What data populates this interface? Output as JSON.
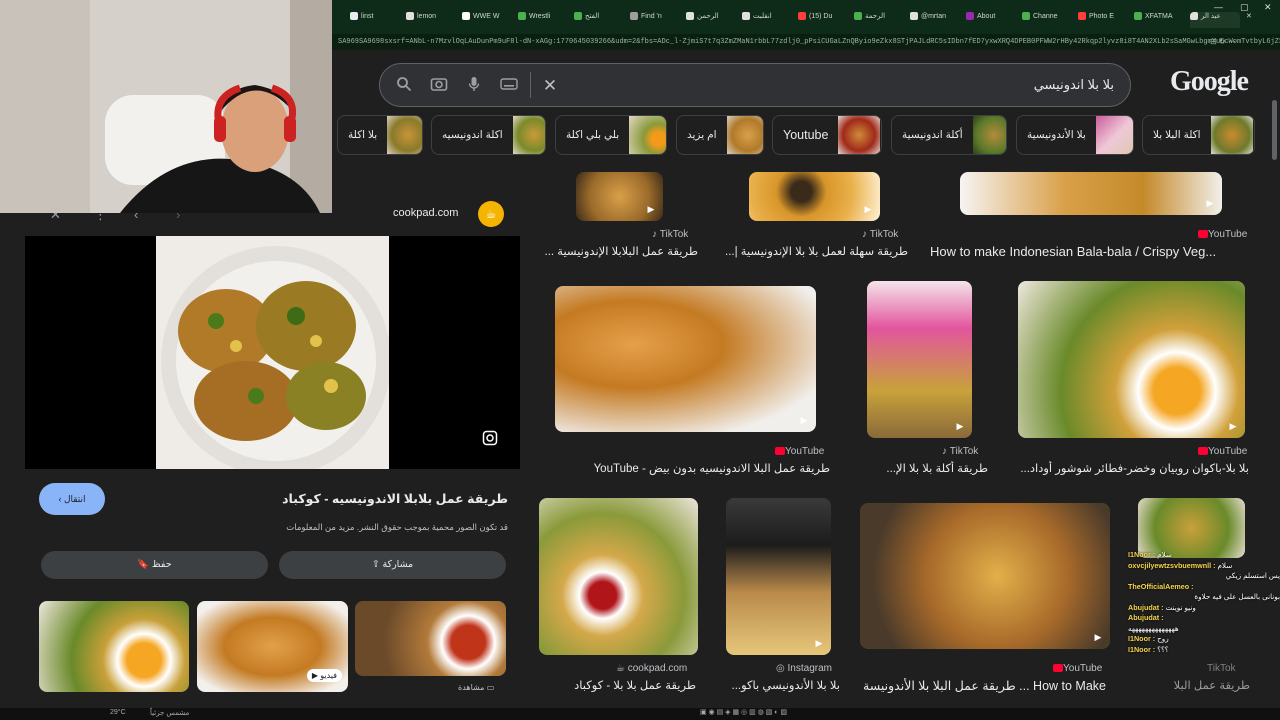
{
  "browser": {
    "tabs": [
      "linst",
      "lemon",
      "WWE W",
      "Wrestli",
      "الفتح",
      "Find 'n",
      "الرحمن",
      "انقلبت",
      "(15) Du",
      "الرحمة",
      "@mrtan",
      "About",
      "Channe",
      "Photo E",
      "XFATMA",
      "عبد الر"
    ],
    "url": "SA969SA9698sxsrf=ANbL-n7MzvlOqLAuDunPm9uF8l-dN-xAGg:1770645039266&udm=2&fbs=ADc_l-ZjmiS7t7q3ZmZMaN1rbbL77zdlj0_pPsiCUGaLZnQByio9eZkx8STjPAJLdRC5sIDbn7fED7yxwXRQ4DPEB0PFWW2rHBy42Rkqp2lyvz8i8T4AN2XLb2sSaMGwLbgmYu6cWomTvtbyL6jZS"
  },
  "search": {
    "logo": "Google",
    "query": "بلا بلا اندونيسي",
    "clear_label": "✕"
  },
  "chips": [
    "اكلة البلا بلا",
    "بلا الأندونيسية",
    "أكلة اندونيسية",
    "Youtube",
    "ام يزيد",
    "بلي بلي اكلة",
    "اكلة اندونيسيه",
    "بلا اكلة"
  ],
  "panel": {
    "source": "cookpad.com",
    "title": "طريقة عمل بلابلا الاندونيسيه - كوكباد",
    "note": "قد تكون الصور محمية بموجب حقوق النشر. مزيد من المعلومات",
    "visit_label": "انتقال",
    "save_label": "حفظ",
    "share_label": "مشاركة",
    "related_badge": "فيديو",
    "related_more": "مشاهدة"
  },
  "results": [
    {
      "source": "TikTok",
      "caption": "طريقة عمل البلابلا الإندونيسية ..."
    },
    {
      "source": "TikTok",
      "caption": "طريقة سهلة لعمل بلا بلا الإندونيسية |..."
    },
    {
      "source": "YouTube",
      "caption": "How to make Indonesian Bala-bala / Crispy Veg..."
    },
    {
      "source": "YouTube",
      "caption": "طريقة عمل البلا الاندونيسيه بدون بيض - YouTube"
    },
    {
      "source": "TikTok",
      "caption": "طريقة أكلة بلا بلا الإ..."
    },
    {
      "source": "YouTube",
      "caption": "بلا بلا-باكوان روبيان وخضر-فطائر شوشور أوداد..."
    },
    {
      "source": "cookpad.com",
      "caption": "طريقة عمل بلا بلا - كوكباد"
    },
    {
      "source": "Instagram",
      "caption": "بلا بلا الأندونيسي باكو..."
    },
    {
      "source": "YouTube",
      "caption": "How to Make ... طريقة عمل البلا بلا الأندونيسة"
    },
    {
      "source": "TikTok",
      "caption": "طريقة عمل البلا"
    }
  ],
  "chat": [
    {
      "name": "I1Noor :",
      "text": "سلام"
    },
    {
      "name": "oxvcjilyewtzsvbuemwnll :",
      "text": "سلام"
    },
    {
      "name": "",
      "text": "يس استسلم زيكي"
    },
    {
      "name": "TheOfficialAemeo :",
      "text": "بونانى بالعسل على فيه حلاوة"
    },
    {
      "name": "Abujudat :",
      "text": "ونيو نوينت"
    },
    {
      "name": "Abujudat :",
      "text": "ههههههههههههههه"
    },
    {
      "name": "I1Noor :",
      "text": "روح"
    },
    {
      "name": "I1Noor :",
      "text": "؟؟؟"
    }
  ],
  "taskbar": {
    "weather": "29°C",
    "status": "مشمس جزئياً"
  }
}
